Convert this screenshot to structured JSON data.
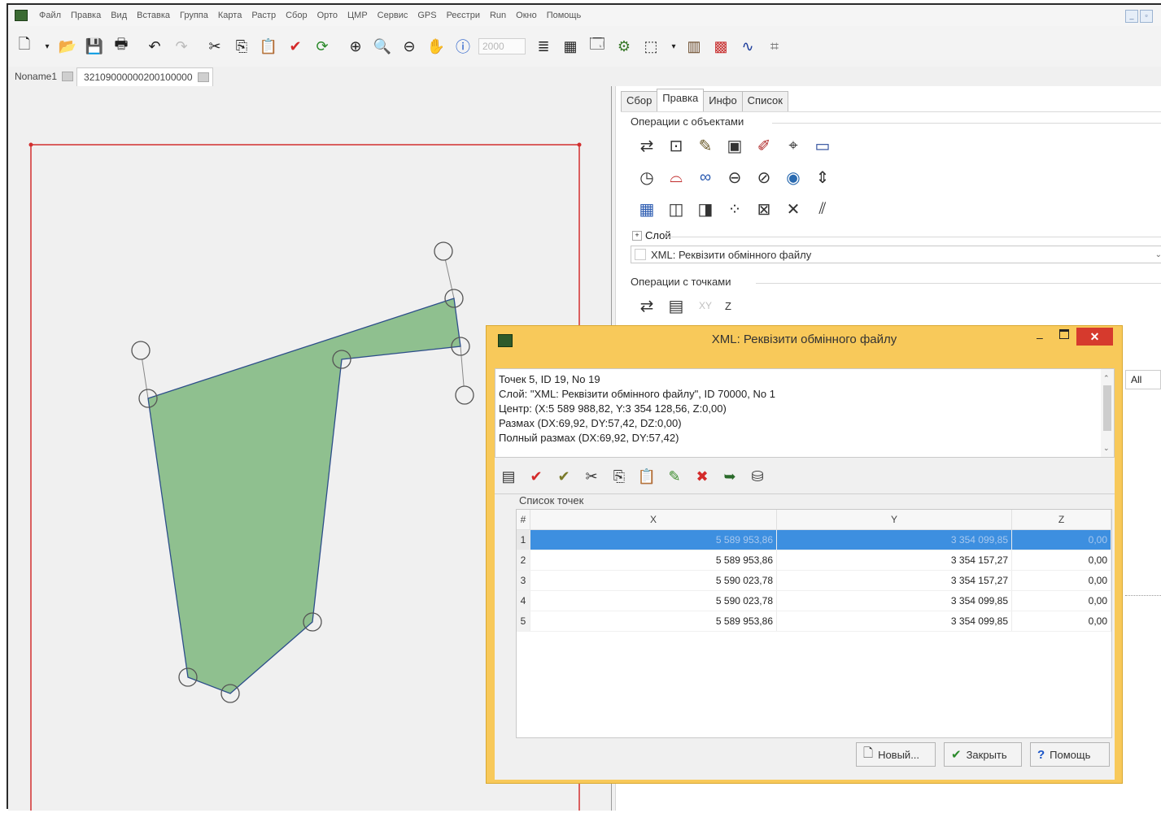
{
  "menu": [
    "Файл",
    "Правка",
    "Вид",
    "Вставка",
    "Группа",
    "Карта",
    "Растр",
    "Сбор",
    "Орто",
    "ЦМР",
    "Сервис",
    "GPS",
    "Реєстри",
    "Run",
    "Окно",
    "Помощь"
  ],
  "toolbar": {
    "icons": [
      "new-icon",
      "open-icon",
      "save-icon",
      "print-icon",
      "undo-icon",
      "redo-icon",
      "cut-icon",
      "copy-icon",
      "paste-icon",
      "check-icon",
      "refresh-icon",
      "zoom-layer-icon",
      "zoom-in-icon",
      "zoom-out-icon",
      "pan-hand-icon",
      "info-icon",
      "layers-icon",
      "table-icon",
      "properties-icon",
      "tools-icon",
      "select-icon",
      "raster-icon",
      "map-icon",
      "curve-icon",
      "grid-icon"
    ],
    "zoom_value": "2000"
  },
  "tabs": {
    "doc1": "Noname1",
    "doc2": "32109000000200100000"
  },
  "panel": {
    "tabs": [
      "Сбор",
      "Правка",
      "Инфо",
      "Список"
    ],
    "active_tab": "Правка",
    "objects_section": "Операции с объектами",
    "layer_label": "Слой",
    "layer_value": "XML: Реквізити обмінного файлу",
    "points_section": "Операции с точками",
    "points_ops": [
      "move-points-icon",
      "edit-table-icon",
      "XY",
      "Z"
    ],
    "object_icons_row1": [
      "move-icon",
      "frame-icon",
      "brush-icon",
      "image-icon",
      "pin-icon",
      "target-icon",
      "line-icon"
    ],
    "object_icons_row2": [
      "clock-icon",
      "arc-icon",
      "union-icon",
      "intersect-icon",
      "difference-icon",
      "circle-icon",
      "split-icon"
    ],
    "object_icons_row3": [
      "grid-icon",
      "square-icon",
      "file-icon",
      "scatter-icon",
      "pattern-icon",
      "cross-icon",
      "hatch-icon"
    ],
    "right_fragment": "All"
  },
  "dialog": {
    "title": "XML: Реквізити обмінного файлу",
    "info_lines": [
      "Точек 5, ID 19, No 19",
      "Слой: \"XML: Реквізити обмінного файлу\", ID 70000, No 1",
      "Центр: (X:5 589 988,82, Y:3 354 128,56, Z:0,00)",
      "Размах (DX:69,92, DY:57,42, DZ:0,00)",
      "Полный размах (DX:69,92, DY:57,42)"
    ],
    "toolbar_icons": [
      "edit-table-icon",
      "check-icon",
      "check-gray-icon",
      "cut-icon",
      "copy-icon",
      "paste-icon",
      "pen-icon",
      "delete-icon",
      "move-icon",
      "stack-icon"
    ],
    "list_title": "Список точек",
    "columns": [
      "#",
      "X",
      "Y",
      "Z"
    ],
    "rows": [
      [
        "1",
        "5 589 953,86",
        "3 354 099,85",
        "0,00"
      ],
      [
        "2",
        "5 589 953,86",
        "3 354 157,27",
        "0,00"
      ],
      [
        "3",
        "5 590 023,78",
        "3 354 157,27",
        "0,00"
      ],
      [
        "4",
        "5 590 023,78",
        "3 354 099,85",
        "0,00"
      ],
      [
        "5",
        "5 589 953,86",
        "3 354 099,85",
        "0,00"
      ]
    ],
    "selected_row": 1,
    "buttons": {
      "new": "Новый...",
      "close": "Закрыть",
      "help": "Помощь"
    }
  },
  "colors": {
    "polygon_fill": "#8fc08f",
    "polygon_stroke": "#2d4e8a",
    "frame": "#d22f2f",
    "dialog_border": "#f8c95a",
    "selection": "#3d8fe0",
    "close_button": "#d63a2d"
  }
}
